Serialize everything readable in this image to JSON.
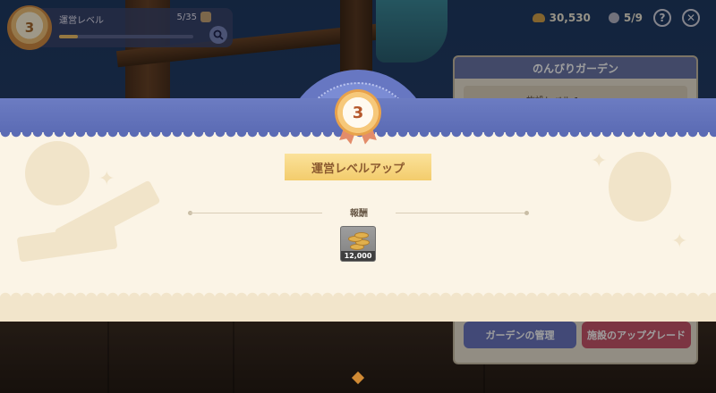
{
  "hud": {
    "level_number": "3",
    "level_title": "運営レベル",
    "level_progress_text": "5/35",
    "level_progress": 0.14,
    "coins": "30,530",
    "tickets": "5/9",
    "help_label": "?",
    "close_label": "✕"
  },
  "garden_panel": {
    "title": "のんびりガーデン",
    "subrow_label": "施設レベル 1",
    "manage_button": "ガーデンの管理",
    "upgrade_button": "施設のアップグレード"
  },
  "levelup": {
    "level_number": "3",
    "title": "運営レベルアップ",
    "rewards_label": "報酬",
    "rewards": [
      {
        "icon": "coins-icon",
        "amount": "12,000"
      }
    ]
  },
  "colors": {
    "banner_blue": "#5b6bb4",
    "banner_cream": "#fbf4e6",
    "ribbon_gold": "#f3cc6c",
    "manage_button": "#6b77c0",
    "upgrade_button": "#c9566b"
  }
}
